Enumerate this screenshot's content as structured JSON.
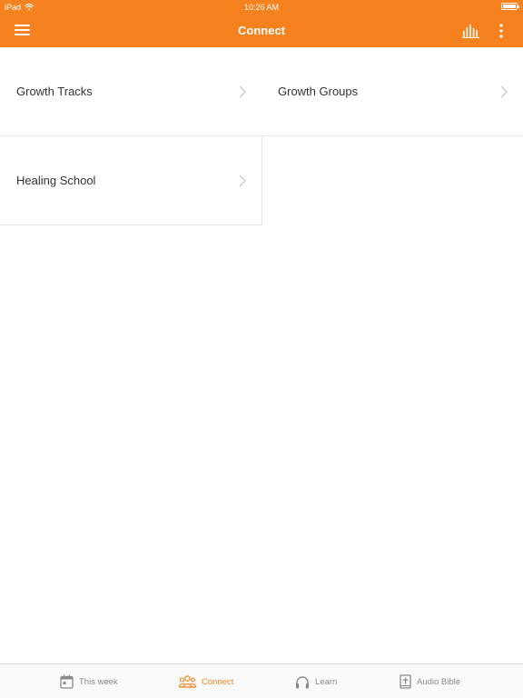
{
  "status_bar": {
    "device": "iPad",
    "time": "10:26 AM"
  },
  "nav": {
    "title": "Connect",
    "menu_icon": "hamburger-menu-icon",
    "audio_icon": "audio-levels-icon",
    "more_icon": "more-vertical-icon"
  },
  "grid": {
    "items": [
      {
        "label": "Growth Tracks"
      },
      {
        "label": "Growth Groups"
      },
      {
        "label": "Healing School"
      }
    ]
  },
  "tabs": [
    {
      "label": "This week",
      "icon": "calendar-icon",
      "active": false
    },
    {
      "label": "Connect",
      "icon": "people-icon",
      "active": true
    },
    {
      "label": "Learn",
      "icon": "headphones-icon",
      "active": false
    },
    {
      "label": "Audio Bible",
      "icon": "bible-icon",
      "active": false
    }
  ],
  "colors": {
    "accent": "#f5821f",
    "tab_inactive": "#8a8a8a",
    "divider": "#e6e6e6"
  }
}
